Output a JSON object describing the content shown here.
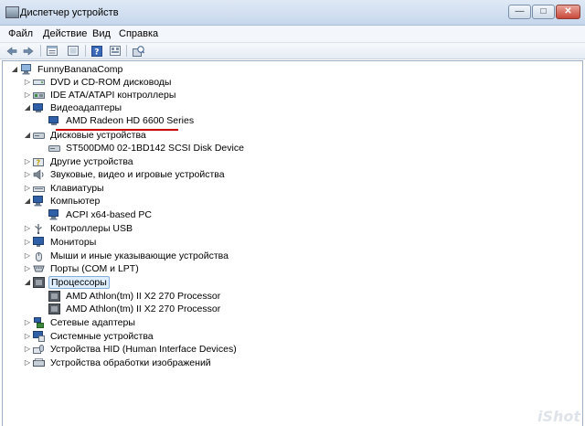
{
  "window": {
    "title": "Диспетчер устройств"
  },
  "menu": [
    "Файл",
    "Действие",
    "Вид",
    "Справка"
  ],
  "toolbar_icons": [
    "back-arrow-icon",
    "forward-arrow-icon",
    "properties-icon",
    "show-hidden-icon",
    "help-icon",
    "view-resources-icon",
    "scan-hardware-icon"
  ],
  "tree": {
    "root": "FunnyBananaComp",
    "nodes": [
      {
        "label": "DVD и CD-ROM дисководы",
        "expanded": false
      },
      {
        "label": "IDE ATA/ATAPI контроллеры",
        "expanded": false
      },
      {
        "label": "Видеоадаптеры",
        "expanded": true,
        "children": [
          "AMD Radeon HD 6600 Series"
        ]
      },
      {
        "label": "Дисковые устройства",
        "expanded": true,
        "children": [
          "ST500DM0 02-1BD142 SCSI Disk Device"
        ]
      },
      {
        "label": "Другие устройства",
        "expanded": false
      },
      {
        "label": "Звуковые, видео и игровые устройства",
        "expanded": false
      },
      {
        "label": "Клавиатуры",
        "expanded": false
      },
      {
        "label": "Компьютер",
        "expanded": true,
        "children": [
          "ACPI x64-based PC"
        ]
      },
      {
        "label": "Контроллеры USB",
        "expanded": false
      },
      {
        "label": "Мониторы",
        "expanded": false
      },
      {
        "label": "Мыши и иные указывающие устройства",
        "expanded": false
      },
      {
        "label": "Порты (COM и LPT)",
        "expanded": false
      },
      {
        "label": "Процессоры",
        "expanded": true,
        "selected": true,
        "children": [
          "AMD Athlon(tm) II X2 270 Processor",
          "AMD Athlon(tm) II X2 270 Processor"
        ]
      },
      {
        "label": "Сетевые адаптеры",
        "expanded": false
      },
      {
        "label": "Системные устройства",
        "expanded": false
      },
      {
        "label": "Устройства HID (Human Interface Devices)",
        "expanded": false
      },
      {
        "label": "Устройства обработки изображений",
        "expanded": false
      }
    ]
  },
  "watermark": "iShot"
}
